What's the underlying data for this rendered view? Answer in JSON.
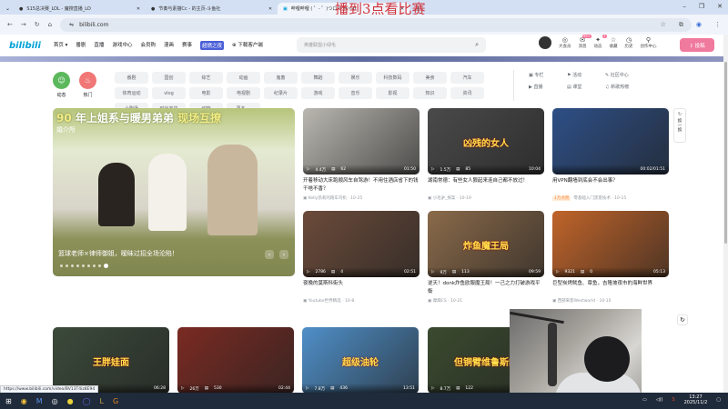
{
  "browser": {
    "tabs": [
      {
        "label": "S15总决赛_LOL - 魔搜直播_LO"
      },
      {
        "label": "节奏与素描Cc - 的主页-斗鱼社"
      },
      {
        "label": "哔哩哔哩 ( ゜- ゜)つロ 干杯~-b"
      }
    ],
    "new_tab": "+",
    "url": "bilibili.com",
    "status_url": "https://www.bilibili.com/video/BV13T4iz8E94"
  },
  "overlay_text": "播到3点看比赛",
  "header": {
    "logo": "bilibili",
    "nav": [
      "首页 ▾",
      "番剧",
      "直播",
      "游戏中心",
      "会员购",
      "漫画",
      "赛事",
      "超燃之夜",
      "下载客户端"
    ],
    "search_placeholder": "英雄联盟小绿毛",
    "icons": [
      {
        "label": "大会员",
        "glyph": "◎"
      },
      {
        "label": "消息",
        "glyph": "✉",
        "badge": "99+"
      },
      {
        "label": "动态",
        "glyph": "✦",
        "badge": "3"
      },
      {
        "label": "收藏",
        "glyph": "☆"
      },
      {
        "label": "历史",
        "glyph": "◷"
      },
      {
        "label": "创作中心",
        "glyph": "⚲"
      }
    ],
    "upload": "⇪ 投稿"
  },
  "channels": {
    "dynamic": "动态",
    "hot": "热门",
    "tags": [
      "番剧",
      "国创",
      "综艺",
      "动画",
      "鬼畜",
      "舞蹈",
      "娱乐",
      "科技数码",
      "美食",
      "汽车",
      "体育运动",
      "vlog",
      "电影",
      "电视剧",
      "纪录片",
      "游戏",
      "音乐",
      "影视",
      "知识",
      "资讯",
      "小剧场",
      "时尚美妆",
      "动物",
      "更多 ⌄"
    ],
    "side": [
      "专栏",
      "活动",
      "社区中心",
      "直播",
      "课堂",
      "新歌热榜"
    ]
  },
  "banner": {
    "headline_a": "90",
    "headline_b": "年上姐系与暖男弟弟",
    "headline_c": "现场互撩",
    "subtitle": "婚介所",
    "caption": "篮球老师×律师御姐，暧昧过招全场沦陷！"
  },
  "refresh": {
    "label": "换一换"
  },
  "cards": [
    {
      "views": "4.4万",
      "danmaku": "62",
      "duration": "01:50",
      "title": "开着移动大床跑顺风车自驾游！不用住酒店省下的钱干啥不香？",
      "author": "Kelly凯莉的跑车司机",
      "date": "10-25",
      "thumb": "#b9b7b0",
      "overlay": ""
    },
    {
      "views": "1.5万",
      "danmaku": "85",
      "duration": "10:04",
      "title": "湖南常德：有些女人狠起来连自己都不放过！",
      "author": "小毛驴_探案",
      "date": "10-19",
      "thumb": "#4a4a4a",
      "overlay": "凶残的女人"
    },
    {
      "views": "",
      "danmaku": "",
      "duration": "00:02/01:51",
      "title": "用VPN翻墙到底会不会出事？",
      "author": "零基础入门黑客技术",
      "date": "10-15",
      "ad": "1万点赞",
      "thumb": "#2d4f86",
      "overlay": ""
    },
    {
      "views": "2786",
      "danmaku": "4",
      "duration": "02:51",
      "title": "夜晚的莫斯科街头",
      "author": "Youtube世界精选",
      "date": "10-8",
      "thumb": "#6b4b3a",
      "overlay": ""
    },
    {
      "views": "9万",
      "danmaku": "113",
      "duration": "09:59",
      "title": "逆天！donk炸鱼欧服魔王局！一己之力打破游戏平衡",
      "author": "摩羯CS",
      "date": "10-21",
      "thumb": "#8a6a4a",
      "overlay": "炸鱼魔王局"
    },
    {
      "views": "9321",
      "danmaku": "0",
      "duration": "05:13",
      "title": "巨型炭烤鱿鱼、章鱼，吉隆坡夜市的海鲜世界",
      "author": "西部来客Westworld",
      "date": "10-10",
      "thumb": "#c0642a",
      "overlay": ""
    },
    {
      "views": "",
      "danmaku": "",
      "duration": "06:28",
      "thumb": "#3b4a3a",
      "overlay": "王胖娃面"
    },
    {
      "views": "26万",
      "danmaku": "530",
      "duration": "02:44",
      "thumb": "#7a2a22",
      "overlay": ""
    },
    {
      "views": "7.8万",
      "danmaku": "436",
      "duration": "13:51",
      "thumb": "#4f8fc8",
      "overlay": "超级油轮"
    },
    {
      "views": "8.7万",
      "danmaku": "122",
      "duration": "",
      "thumb": "#3a4a2e",
      "overlay": "但铜臂维鲁斯的"
    }
  ],
  "taskbar": {
    "time": "13:27",
    "date": "2025/11/2"
  }
}
